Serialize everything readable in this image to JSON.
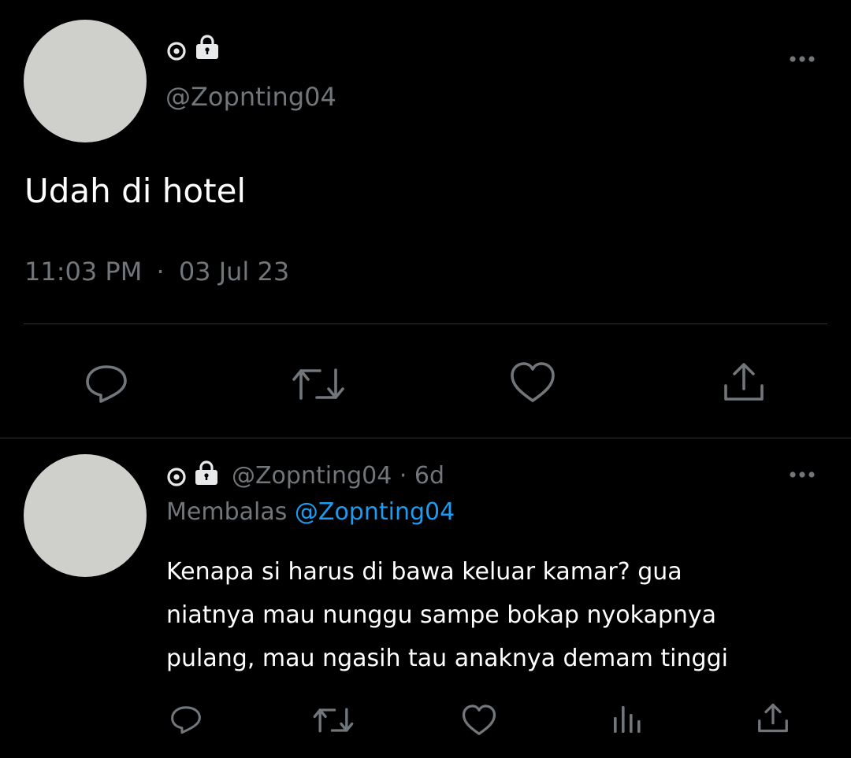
{
  "tweet": {
    "display_name_icons": [
      "circle-dot-icon",
      "lock-icon"
    ],
    "handle": "@Zopnting04",
    "text": "Udah di hotel",
    "time": "11:03 PM",
    "separator": "·",
    "date": "03 Jul 23",
    "actions": [
      "reply-icon",
      "retweet-icon",
      "like-icon",
      "share-icon"
    ]
  },
  "reply": {
    "display_name_icons": [
      "circle-dot-icon",
      "lock-icon"
    ],
    "handle": "@Zopnting04",
    "age": "· 6d",
    "replying_to_label": "Membalas",
    "replying_to_handle": "@Zopnting04",
    "text_lines": [
      "Kenapa si harus di bawa keluar kamar? gua",
      "niatnya mau nunggu sampe bokap nyokapnya",
      "pulang, mau ngasih tau anaknya demam tinggi"
    ],
    "actions": [
      "reply-icon",
      "retweet-icon",
      "like-icon",
      "views-icon",
      "share-icon"
    ]
  },
  "colors": {
    "background": "#000000",
    "text": "#e7e9ea",
    "muted": "#71767b",
    "link": "#1d9bf0",
    "divider": "#2f3336",
    "avatar": "#cfcfcb"
  }
}
